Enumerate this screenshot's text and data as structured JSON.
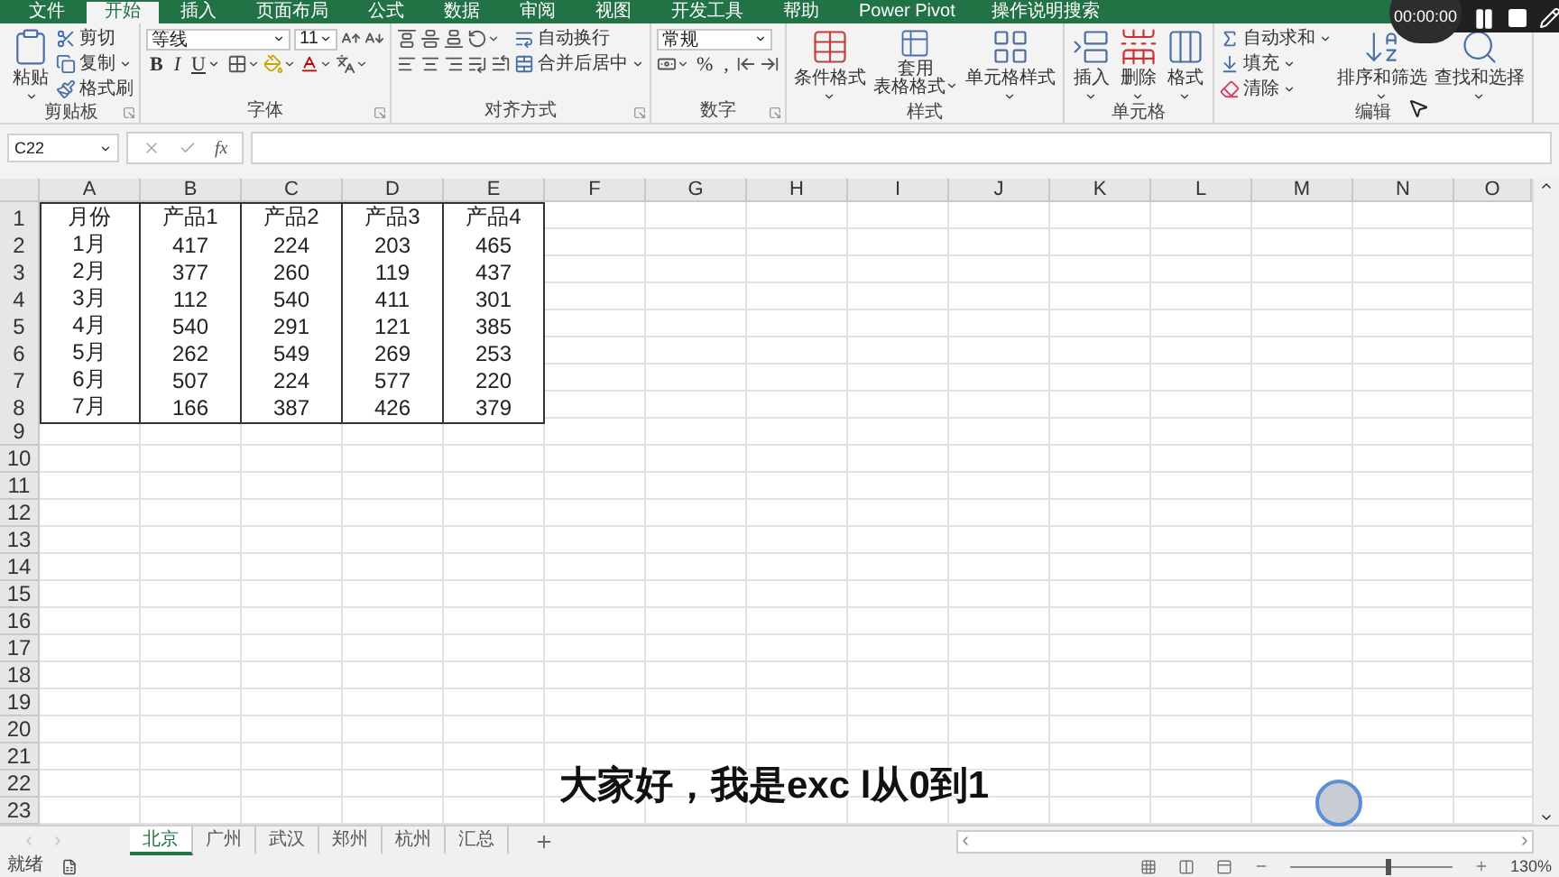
{
  "tabs": [
    {
      "label": "文件",
      "selected": false
    },
    {
      "label": "开始",
      "selected": true
    },
    {
      "label": "插入",
      "selected": false
    },
    {
      "label": "页面布局",
      "selected": false
    },
    {
      "label": "公式",
      "selected": false
    },
    {
      "label": "数据",
      "selected": false
    },
    {
      "label": "审阅",
      "selected": false
    },
    {
      "label": "视图",
      "selected": false
    },
    {
      "label": "开发工具",
      "selected": false
    },
    {
      "label": "帮助",
      "selected": false
    },
    {
      "label": "Power Pivot",
      "selected": false
    }
  ],
  "tell_me": "操作说明搜索",
  "recorder": {
    "time": "00:00:00"
  },
  "ribbon": [
    {
      "label": "剪贴板",
      "launcher": true,
      "columns": [
        [
          [
            {
              "kind": "large",
              "label": "粘贴",
              "menu": true
            }
          ]
        ],
        [
          [
            {
              "kind": "small",
              "label": "剪切"
            }
          ],
          [
            {
              "kind": "small",
              "label": "复制",
              "menu": true
            }
          ],
          [
            {
              "kind": "small",
              "label": "格式刷"
            }
          ]
        ]
      ]
    },
    {
      "label": "字体",
      "launcher": true,
      "columns": [
        [
          [
            {
              "kind": "field",
              "value": "等线"
            },
            {
              "kind": "field",
              "value": "11"
            },
            {
              "kind": "icon"
            },
            {
              "kind": "icon"
            }
          ],
          [
            {
              "kind": "glyph",
              "label": "B"
            },
            {
              "kind": "glyph",
              "label": "I"
            },
            {
              "kind": "glyph",
              "label": "U",
              "menu": true
            },
            {
              "kind": "icon",
              "menu": true
            },
            {
              "kind": "icon",
              "menu": true
            },
            {
              "kind": "icon",
              "menu": true
            },
            {
              "kind": "icon",
              "menu": true
            }
          ]
        ]
      ]
    },
    {
      "label": "对齐方式",
      "launcher": true,
      "columns": [
        [
          [
            {
              "kind": "icon"
            },
            {
              "kind": "icon"
            },
            {
              "kind": "icon"
            },
            {
              "kind": "icon",
              "menu": true
            }
          ],
          [
            {
              "kind": "icon"
            },
            {
              "kind": "icon"
            },
            {
              "kind": "icon"
            },
            {
              "kind": "icon"
            },
            {
              "kind": "icon"
            }
          ]
        ],
        [
          [
            {
              "kind": "small",
              "label": "自动换行"
            }
          ],
          [
            {
              "kind": "small",
              "label": "合并后居中",
              "menu": true
            }
          ]
        ]
      ]
    },
    {
      "label": "数字",
      "launcher": true,
      "columns": [
        [
          [
            {
              "kind": "field",
              "value": "常规"
            }
          ],
          [
            {
              "kind": "icon",
              "menu": true
            },
            {
              "kind": "glyph",
              "label": "%"
            },
            {
              "kind": "glyph",
              "label": ","
            },
            {
              "kind": "icon"
            },
            {
              "kind": "icon"
            }
          ]
        ]
      ]
    },
    {
      "label": "样式",
      "columns": [
        [
          [
            {
              "kind": "large",
              "label": "条件格式",
              "menu": true
            }
          ]
        ],
        [
          [
            {
              "kind": "large",
              "lines": [
                "套用",
                "表格格式"
              ],
              "menu": true
            }
          ]
        ],
        [
          [
            {
              "kind": "large",
              "label": "单元格样式",
              "menu": true
            }
          ]
        ]
      ]
    },
    {
      "label": "单元格",
      "columns": [
        [
          [
            {
              "kind": "large",
              "label": "插入",
              "menu": true
            }
          ]
        ],
        [
          [
            {
              "kind": "large",
              "label": "删除",
              "menu": true
            }
          ]
        ],
        [
          [
            {
              "kind": "large",
              "label": "格式",
              "menu": true
            }
          ]
        ]
      ]
    },
    {
      "label": "编辑",
      "columns": [
        [
          [
            {
              "kind": "small",
              "label": "自动求和",
              "menu": true
            }
          ],
          [
            {
              "kind": "small",
              "label": "填充",
              "menu": true
            }
          ],
          [
            {
              "kind": "small",
              "label": "清除",
              "menu": true
            }
          ]
        ],
        [
          [
            {
              "kind": "large",
              "label": "排序和筛选",
              "menu": true
            }
          ]
        ],
        [
          [
            {
              "kind": "large",
              "label": "查找和选择",
              "menu": true
            }
          ]
        ]
      ]
    }
  ],
  "name_box": "C22",
  "formula_fx": "fx",
  "columns": [
    "A",
    "B",
    "C",
    "D",
    "E",
    "F",
    "G",
    "H",
    "I",
    "J",
    "K",
    "L",
    "M",
    "N",
    "O"
  ],
  "rows": [
    {
      "number": "1",
      "cells": [
        "月份",
        "产品1",
        "产品2",
        "产品3",
        "产品4"
      ]
    },
    {
      "number": "2",
      "cells": [
        "1月",
        "417",
        "224",
        "203",
        "465"
      ]
    },
    {
      "number": "3",
      "cells": [
        "2月",
        "377",
        "260",
        "119",
        "437"
      ]
    },
    {
      "number": "4",
      "cells": [
        "3月",
        "112",
        "540",
        "411",
        "301"
      ]
    },
    {
      "number": "5",
      "cells": [
        "4月",
        "540",
        "291",
        "121",
        "385"
      ]
    },
    {
      "number": "6",
      "cells": [
        "5月",
        "262",
        "549",
        "269",
        "253"
      ]
    },
    {
      "number": "7",
      "cells": [
        "6月",
        "507",
        "224",
        "577",
        "220"
      ]
    },
    {
      "number": "8",
      "cells": [
        "7月",
        "166",
        "387",
        "426",
        "379"
      ]
    },
    {
      "number": "9"
    },
    {
      "number": "10"
    },
    {
      "number": "11"
    },
    {
      "number": "12"
    },
    {
      "number": "13"
    },
    {
      "number": "14"
    },
    {
      "number": "15"
    },
    {
      "number": "16"
    },
    {
      "number": "17"
    },
    {
      "number": "18"
    },
    {
      "number": "19"
    },
    {
      "number": "20"
    },
    {
      "number": "21"
    },
    {
      "number": "22"
    },
    {
      "number": "23"
    }
  ],
  "subtitle": "大家好，我是exc l从0到1",
  "sheets": [
    {
      "label": "北京",
      "selected": true
    },
    {
      "label": "广州",
      "selected": false
    },
    {
      "label": "武汉",
      "selected": false
    },
    {
      "label": "郑州",
      "selected": false
    },
    {
      "label": "杭州",
      "selected": false
    },
    {
      "label": "汇总",
      "selected": false
    }
  ],
  "status": {
    "text": "就绪",
    "zoom": {
      "level": 0.6,
      "reading": "130%"
    }
  }
}
